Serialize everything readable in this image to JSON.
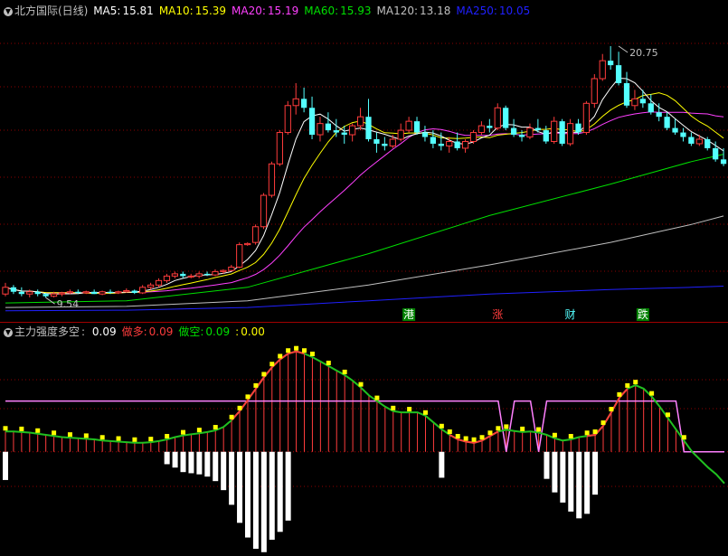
{
  "colors": {
    "up": "#ff3c3c",
    "down": "#54ffff",
    "grid": "#8b0000",
    "ma5": "#ffffff",
    "ma10": "#ffff00",
    "ma20": "#ff40ff",
    "ma60": "#00e000",
    "ma120": "#c0c0c0",
    "ma250": "#2020ff",
    "pink": "#ff80ff",
    "green": "#20c020",
    "yellow": "#ffff00",
    "white": "#ffffff"
  },
  "main_legend": {
    "icon": "chevron-down-icon",
    "title": "北方国际(日线)",
    "items": [
      {
        "label": "MA5:",
        "value": "15.81",
        "color": "#ffffff"
      },
      {
        "label": "MA10:",
        "value": "15.39",
        "color": "#ffff00"
      },
      {
        "label": "MA20:",
        "value": "15.19",
        "color": "#ff40ff"
      },
      {
        "label": "MA60:",
        "value": "15.93",
        "color": "#00e000"
      },
      {
        "label": "MA120:",
        "value": "13.18",
        "color": "#c0c0c0"
      },
      {
        "label": "MA250:",
        "value": "10.05",
        "color": "#2020ff"
      }
    ]
  },
  "sub_legend": {
    "icon": "chevron-down-icon",
    "title": "主力强度多空",
    "sep": ":",
    "items": [
      {
        "label": "",
        "value": "0.09",
        "color": "#ffffff"
      },
      {
        "label": "做多:",
        "value": "0.09",
        "color": "#ff3c3c"
      },
      {
        "label": "做空:",
        "value": "0.09",
        "color": "#00e000"
      },
      {
        "label": ":",
        "value": "0.00",
        "color": "#ffff00"
      }
    ]
  },
  "chart_data": [
    {
      "type": "candlestick",
      "price_range": [
        8.5,
        22.0
      ],
      "annotations": [
        {
          "text": "20.75",
          "value": 20.75,
          "index": 76
        },
        {
          "text": "9.54",
          "value": 9.54,
          "index": 5
        }
      ],
      "event_labels": [
        {
          "text": "港",
          "index": 50,
          "bg": "#008000",
          "fg": "#ffffff"
        },
        {
          "text": "涨",
          "index": 61,
          "bg": "#000000",
          "fg": "#ff3c3c"
        },
        {
          "text": "财",
          "index": 70,
          "bg": "#000000",
          "fg": "#54ffff"
        },
        {
          "text": "跌",
          "index": 79,
          "bg": "#008000",
          "fg": "#ffffff"
        }
      ],
      "candles": [
        [
          9.7,
          10.2,
          9.6,
          10.0
        ],
        [
          10.0,
          10.1,
          9.7,
          9.8
        ],
        [
          9.8,
          10.0,
          9.6,
          9.7
        ],
        [
          9.7,
          9.9,
          9.55,
          9.8
        ],
        [
          9.8,
          9.9,
          9.6,
          9.7
        ],
        [
          9.7,
          9.75,
          9.54,
          9.6
        ],
        [
          9.6,
          9.8,
          9.55,
          9.7
        ],
        [
          9.7,
          9.8,
          9.6,
          9.75
        ],
        [
          9.75,
          9.9,
          9.7,
          9.8
        ],
        [
          9.8,
          9.9,
          9.7,
          9.75
        ],
        [
          9.75,
          9.85,
          9.7,
          9.8
        ],
        [
          9.8,
          9.9,
          9.7,
          9.7
        ],
        [
          9.7,
          9.85,
          9.65,
          9.8
        ],
        [
          9.8,
          9.9,
          9.7,
          9.75
        ],
        [
          9.75,
          9.85,
          9.7,
          9.8
        ],
        [
          9.8,
          9.95,
          9.75,
          9.85
        ],
        [
          9.85,
          9.9,
          9.7,
          9.75
        ],
        [
          9.75,
          10.1,
          9.7,
          10.0
        ],
        [
          10.0,
          10.2,
          9.9,
          10.1
        ],
        [
          10.1,
          10.4,
          10.0,
          10.3
        ],
        [
          10.3,
          10.6,
          10.2,
          10.5
        ],
        [
          10.5,
          10.7,
          10.4,
          10.6
        ],
        [
          10.6,
          10.7,
          10.4,
          10.5
        ],
        [
          10.5,
          10.6,
          10.4,
          10.5
        ],
        [
          10.5,
          10.7,
          10.4,
          10.6
        ],
        [
          10.6,
          10.7,
          10.5,
          10.55
        ],
        [
          10.55,
          10.8,
          10.5,
          10.7
        ],
        [
          10.7,
          10.8,
          10.6,
          10.75
        ],
        [
          10.75,
          11.0,
          10.7,
          10.9
        ],
        [
          10.9,
          12.0,
          10.85,
          11.9
        ],
        [
          11.9,
          12.0,
          11.85,
          11.95
        ],
        [
          12.0,
          12.8,
          11.9,
          12.7
        ],
        [
          12.7,
          14.2,
          12.6,
          14.1
        ],
        [
          14.1,
          15.6,
          14.0,
          15.5
        ],
        [
          15.5,
          17.0,
          15.4,
          16.9
        ],
        [
          16.9,
          18.3,
          16.8,
          18.1
        ],
        [
          18.1,
          19.1,
          17.7,
          18.4
        ],
        [
          18.4,
          18.9,
          17.8,
          18.0
        ],
        [
          18.0,
          18.5,
          16.6,
          16.8
        ],
        [
          16.8,
          17.6,
          16.5,
          17.3
        ],
        [
          17.3,
          17.8,
          16.9,
          17.0
        ],
        [
          17.0,
          17.5,
          16.7,
          16.9
        ],
        [
          16.9,
          17.2,
          16.4,
          16.8
        ],
        [
          16.8,
          17.3,
          16.5,
          17.2
        ],
        [
          17.2,
          18.0,
          17.0,
          17.6
        ],
        [
          17.6,
          18.4,
          16.5,
          16.6
        ],
        [
          16.6,
          16.9,
          16.0,
          16.4
        ],
        [
          16.4,
          16.7,
          16.1,
          16.3
        ],
        [
          16.3,
          16.8,
          16.2,
          16.6
        ],
        [
          16.6,
          17.3,
          16.5,
          17.0
        ],
        [
          17.0,
          17.6,
          16.9,
          17.4
        ],
        [
          17.4,
          17.6,
          16.8,
          16.9
        ],
        [
          16.9,
          17.2,
          16.5,
          16.7
        ],
        [
          16.7,
          17.0,
          16.2,
          16.4
        ],
        [
          16.4,
          16.9,
          16.1,
          16.3
        ],
        [
          16.3,
          16.7,
          16.0,
          16.5
        ],
        [
          16.5,
          16.9,
          16.1,
          16.2
        ],
        [
          16.2,
          16.6,
          16.0,
          16.5
        ],
        [
          16.5,
          17.0,
          16.4,
          16.9
        ],
        [
          16.9,
          17.4,
          16.8,
          17.2
        ],
        [
          17.2,
          17.5,
          16.9,
          17.1
        ],
        [
          17.1,
          18.2,
          17.0,
          18.0
        ],
        [
          18.0,
          18.1,
          17.0,
          17.1
        ],
        [
          17.1,
          17.5,
          16.7,
          16.8
        ],
        [
          16.8,
          17.0,
          16.5,
          16.7
        ],
        [
          16.7,
          17.3,
          16.6,
          17.1
        ],
        [
          17.1,
          17.5,
          16.9,
          17.0
        ],
        [
          17.0,
          17.2,
          16.4,
          16.5
        ],
        [
          16.5,
          17.6,
          16.4,
          17.4
        ],
        [
          17.4,
          17.5,
          16.3,
          16.4
        ],
        [
          16.4,
          17.5,
          16.3,
          17.3
        ],
        [
          17.3,
          17.5,
          16.8,
          16.9
        ],
        [
          16.9,
          18.3,
          16.8,
          18.2
        ],
        [
          18.2,
          19.5,
          18.0,
          19.3
        ],
        [
          19.3,
          20.4,
          19.2,
          20.1
        ],
        [
          20.1,
          20.75,
          19.7,
          19.9
        ],
        [
          19.9,
          20.5,
          19.0,
          19.1
        ],
        [
          19.1,
          19.6,
          18.0,
          18.1
        ],
        [
          18.1,
          18.8,
          17.9,
          18.4
        ],
        [
          18.4,
          18.8,
          18.0,
          18.2
        ],
        [
          18.2,
          18.6,
          17.7,
          17.8
        ],
        [
          17.8,
          18.2,
          17.4,
          17.6
        ],
        [
          17.6,
          17.8,
          17.0,
          17.1
        ],
        [
          17.1,
          17.5,
          16.8,
          16.9
        ],
        [
          16.9,
          17.1,
          16.5,
          16.7
        ],
        [
          16.7,
          16.9,
          16.3,
          16.4
        ],
        [
          16.4,
          16.8,
          16.3,
          16.6
        ],
        [
          16.6,
          16.7,
          16.1,
          16.2
        ],
        [
          16.2,
          16.5,
          15.6,
          15.7
        ],
        [
          15.7,
          16.2,
          15.4,
          15.5
        ]
      ],
      "ma_long": {
        "ma60": {
          "x": [
            0,
            15,
            30,
            45,
            60,
            75,
            85,
            89
          ],
          "y": [
            9.3,
            9.4,
            10.0,
            11.5,
            13.2,
            14.6,
            15.6,
            15.93
          ]
        },
        "ma120": {
          "x": [
            0,
            15,
            30,
            45,
            60,
            75,
            85,
            89
          ],
          "y": [
            9.1,
            9.15,
            9.4,
            10.1,
            11.0,
            12.0,
            12.8,
            13.18
          ]
        },
        "ma250": {
          "x": [
            0,
            15,
            30,
            45,
            60,
            75,
            85,
            89
          ],
          "y": [
            8.95,
            8.98,
            9.1,
            9.4,
            9.7,
            9.9,
            10.0,
            10.05
          ]
        }
      }
    },
    {
      "type": "mixed",
      "x_count": 90,
      "range": [
        -9.0,
        10.0
      ],
      "baseline": 0,
      "main_line": [
        1.8,
        1.8,
        1.75,
        1.7,
        1.6,
        1.5,
        1.4,
        1.3,
        1.25,
        1.2,
        1.15,
        1.1,
        1.0,
        0.95,
        0.9,
        0.85,
        0.8,
        0.8,
        0.85,
        0.95,
        1.1,
        1.3,
        1.45,
        1.55,
        1.65,
        1.75,
        1.9,
        2.2,
        2.8,
        3.6,
        4.6,
        5.6,
        6.6,
        7.5,
        8.2,
        8.7,
        8.9,
        8.7,
        8.4,
        8.0,
        7.6,
        7.2,
        6.8,
        6.3,
        5.7,
        5.0,
        4.5,
        4.0,
        3.6,
        3.5,
        3.5,
        3.5,
        3.2,
        2.6,
        2.0,
        1.5,
        1.1,
        0.9,
        0.8,
        1.0,
        1.4,
        1.8,
        1.95,
        1.85,
        1.75,
        1.8,
        1.7,
        1.5,
        1.2,
        1.0,
        1.1,
        1.3,
        1.4,
        1.5,
        2.3,
        3.5,
        4.8,
        5.6,
        5.9,
        5.6,
        4.9,
        4.0,
        3.0,
        2.0,
        1.0,
        0.0,
        -0.7,
        -1.4,
        -2.0,
        -2.8
      ],
      "red_segments": [
        [
          28,
          37
        ],
        [
          55,
          61
        ],
        [
          72,
          77
        ]
      ],
      "pink_line": [
        4.5,
        4.5,
        4.5,
        4.5,
        4.5,
        4.5,
        4.5,
        4.5,
        4.5,
        4.5,
        4.5,
        4.5,
        4.5,
        4.5,
        4.5,
        4.5,
        4.5,
        4.5,
        4.5,
        4.5,
        4.5,
        4.5,
        4.5,
        4.5,
        4.5,
        4.5,
        4.5,
        4.5,
        4.5,
        4.5,
        4.5,
        4.5,
        4.5,
        4.5,
        4.5,
        4.5,
        4.5,
        4.5,
        4.5,
        4.5,
        4.5,
        4.5,
        4.5,
        4.5,
        4.5,
        4.5,
        4.5,
        4.5,
        4.5,
        4.5,
        4.5,
        4.5,
        4.5,
        4.5,
        4.5,
        4.5,
        4.5,
        4.5,
        4.5,
        4.5,
        4.5,
        4.5,
        0.0,
        4.5,
        4.5,
        4.5,
        0.0,
        4.5,
        4.5,
        4.5,
        4.5,
        4.5,
        4.5,
        4.5,
        4.5,
        4.5,
        4.5,
        4.5,
        4.5,
        4.5,
        4.5,
        4.5,
        4.5,
        4.5,
        0.0,
        0.0,
        0.0,
        0.0,
        0.0,
        0.0
      ],
      "bars": [
        -2.5,
        0,
        0,
        0,
        0,
        0,
        0,
        0,
        0,
        0,
        0,
        0,
        0,
        0,
        0,
        0,
        0,
        0,
        0,
        0,
        -1.1,
        -1.4,
        -1.8,
        -1.9,
        -2.0,
        -2.2,
        -2.6,
        -3.4,
        -4.7,
        -6.3,
        -7.6,
        -8.6,
        -8.9,
        -7.8,
        -7.1,
        -6.1,
        0,
        0,
        0,
        0,
        0,
        0,
        0,
        0,
        0,
        0,
        0,
        0,
        0,
        0,
        0,
        0,
        0,
        0,
        -2.3,
        0,
        0,
        0,
        0,
        0,
        0,
        0,
        0,
        0,
        0,
        0,
        0,
        -2.4,
        -3.6,
        -4.5,
        -5.3,
        -5.9,
        -5.5,
        -3.8,
        0,
        0,
        0,
        0,
        0,
        0,
        0,
        0,
        0,
        0,
        0,
        0,
        0,
        0,
        0,
        0
      ]
    }
  ]
}
